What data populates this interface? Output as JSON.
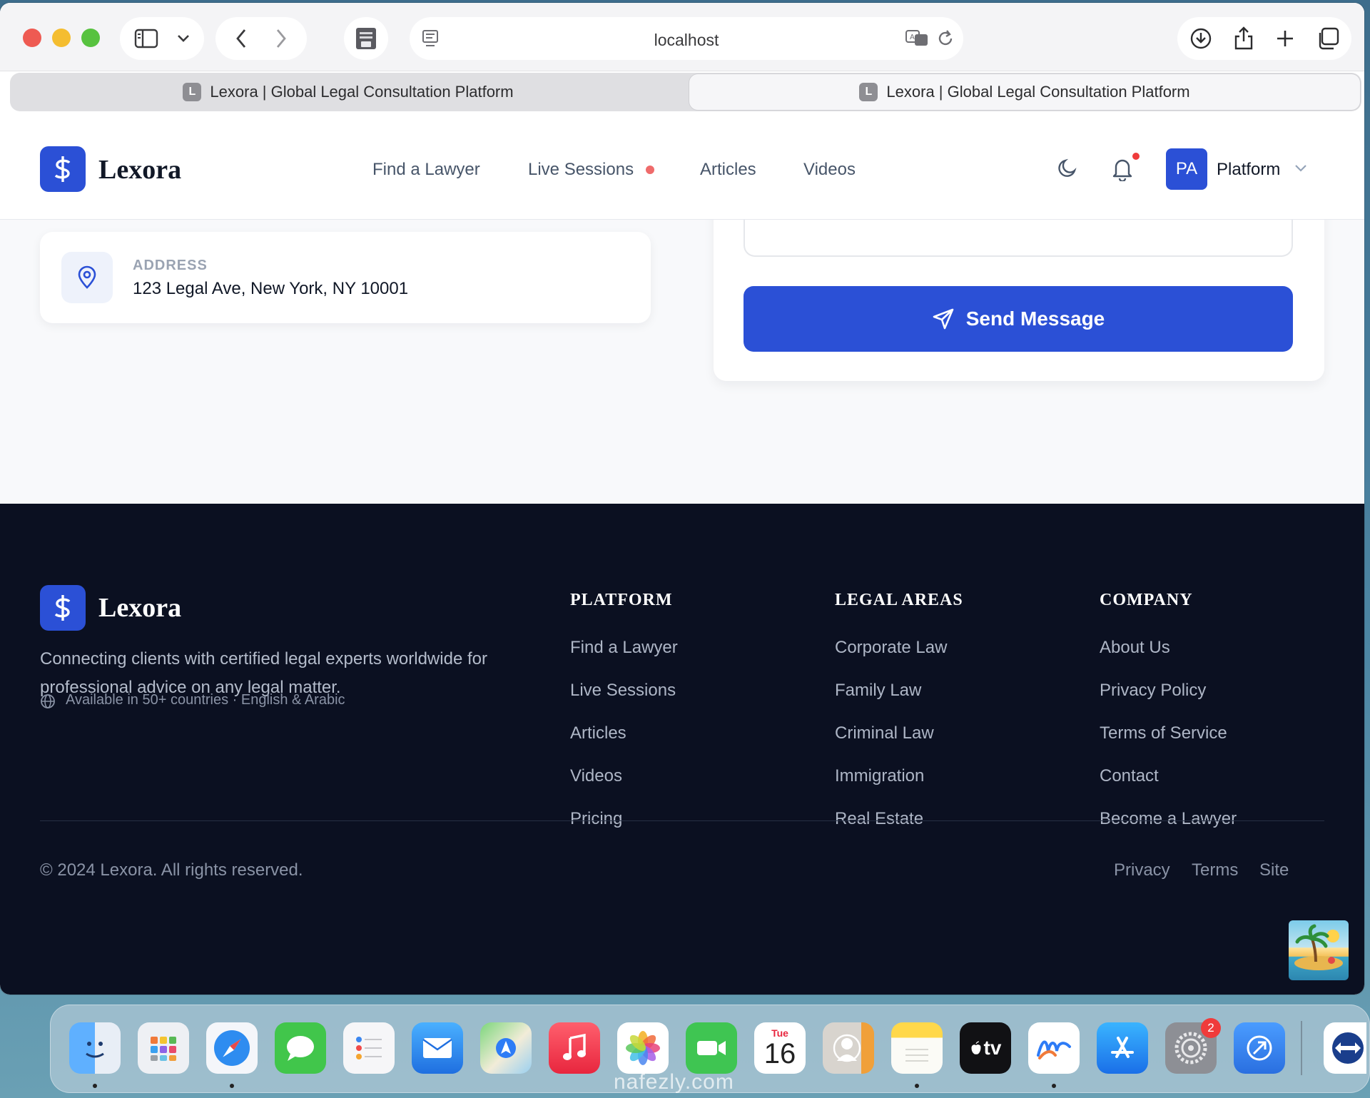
{
  "browser": {
    "address": "localhost",
    "tabs": [
      {
        "label": "Lexora | Global Legal Consultation Platform",
        "favicon": "L"
      },
      {
        "label": "Lexora | Global Legal Consultation Platform",
        "favicon": "L"
      }
    ]
  },
  "nav": {
    "brand": "Lexora",
    "links": [
      "Find a Lawyer",
      "Live Sessions",
      "Articles",
      "Videos"
    ],
    "avatar_initials": "PA",
    "user_name": "Platform"
  },
  "contact": {
    "address_label": "ADDRESS",
    "address_value": "123 Legal Ave, New York, NY 10001",
    "send_label": "Send Message"
  },
  "footer": {
    "brand": "Lexora",
    "description": "Connecting clients with certified legal experts worldwide for professional advice on any legal matter.",
    "availability": "Available in 50+ countries · English & Arabic",
    "columns": [
      {
        "title": "PLATFORM",
        "links": [
          "Find a Lawyer",
          "Live Sessions",
          "Articles",
          "Videos",
          "Pricing"
        ]
      },
      {
        "title": "LEGAL AREAS",
        "links": [
          "Corporate Law",
          "Family Law",
          "Criminal Law",
          "Immigration",
          "Real Estate"
        ]
      },
      {
        "title": "COMPANY",
        "links": [
          "About Us",
          "Privacy Policy",
          "Terms of Service",
          "Contact",
          "Become a Lawyer"
        ]
      }
    ],
    "copyright": "© 2024 Lexora. All rights reserved.",
    "bottom_links": [
      "Privacy",
      "Terms",
      "Site"
    ]
  },
  "dock": {
    "apps": [
      "finder-icon",
      "launchpad-icon",
      "safari-icon",
      "messages-icon",
      "reminders-icon",
      "mail-icon",
      "maps-icon",
      "music-icon",
      "photos-icon",
      "facetime-icon",
      "calendar-icon",
      "contacts-icon",
      "notes-icon",
      "tv-icon",
      "freeform-icon",
      "app-store-icon",
      "system-settings-icon",
      "migration-icon",
      "teamviewer-icon"
    ],
    "calendar_day": "Tue",
    "calendar_date": "16",
    "tv_label": "tv",
    "settings_badge": "2"
  },
  "watermark": "nafezly.com",
  "colors": {
    "accent": "#2b50d6",
    "footer_bg": "#0b1021"
  }
}
